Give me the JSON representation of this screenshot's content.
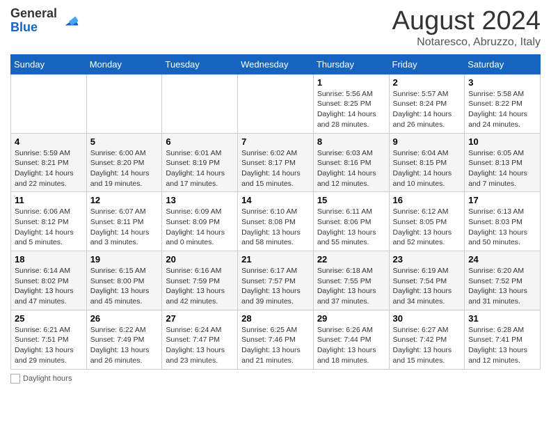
{
  "header": {
    "logo_general": "General",
    "logo_blue": "Blue",
    "month_title": "August 2024",
    "location": "Notaresco, Abruzzo, Italy"
  },
  "days_of_week": [
    "Sunday",
    "Monday",
    "Tuesday",
    "Wednesday",
    "Thursday",
    "Friday",
    "Saturday"
  ],
  "weeks": [
    [
      {
        "day": "",
        "info": ""
      },
      {
        "day": "",
        "info": ""
      },
      {
        "day": "",
        "info": ""
      },
      {
        "day": "",
        "info": ""
      },
      {
        "day": "1",
        "info": "Sunrise: 5:56 AM\nSunset: 8:25 PM\nDaylight: 14 hours and 28 minutes."
      },
      {
        "day": "2",
        "info": "Sunrise: 5:57 AM\nSunset: 8:24 PM\nDaylight: 14 hours and 26 minutes."
      },
      {
        "day": "3",
        "info": "Sunrise: 5:58 AM\nSunset: 8:22 PM\nDaylight: 14 hours and 24 minutes."
      }
    ],
    [
      {
        "day": "4",
        "info": "Sunrise: 5:59 AM\nSunset: 8:21 PM\nDaylight: 14 hours and 22 minutes."
      },
      {
        "day": "5",
        "info": "Sunrise: 6:00 AM\nSunset: 8:20 PM\nDaylight: 14 hours and 19 minutes."
      },
      {
        "day": "6",
        "info": "Sunrise: 6:01 AM\nSunset: 8:19 PM\nDaylight: 14 hours and 17 minutes."
      },
      {
        "day": "7",
        "info": "Sunrise: 6:02 AM\nSunset: 8:17 PM\nDaylight: 14 hours and 15 minutes."
      },
      {
        "day": "8",
        "info": "Sunrise: 6:03 AM\nSunset: 8:16 PM\nDaylight: 14 hours and 12 minutes."
      },
      {
        "day": "9",
        "info": "Sunrise: 6:04 AM\nSunset: 8:15 PM\nDaylight: 14 hours and 10 minutes."
      },
      {
        "day": "10",
        "info": "Sunrise: 6:05 AM\nSunset: 8:13 PM\nDaylight: 14 hours and 7 minutes."
      }
    ],
    [
      {
        "day": "11",
        "info": "Sunrise: 6:06 AM\nSunset: 8:12 PM\nDaylight: 14 hours and 5 minutes."
      },
      {
        "day": "12",
        "info": "Sunrise: 6:07 AM\nSunset: 8:11 PM\nDaylight: 14 hours and 3 minutes."
      },
      {
        "day": "13",
        "info": "Sunrise: 6:09 AM\nSunset: 8:09 PM\nDaylight: 14 hours and 0 minutes."
      },
      {
        "day": "14",
        "info": "Sunrise: 6:10 AM\nSunset: 8:08 PM\nDaylight: 13 hours and 58 minutes."
      },
      {
        "day": "15",
        "info": "Sunrise: 6:11 AM\nSunset: 8:06 PM\nDaylight: 13 hours and 55 minutes."
      },
      {
        "day": "16",
        "info": "Sunrise: 6:12 AM\nSunset: 8:05 PM\nDaylight: 13 hours and 52 minutes."
      },
      {
        "day": "17",
        "info": "Sunrise: 6:13 AM\nSunset: 8:03 PM\nDaylight: 13 hours and 50 minutes."
      }
    ],
    [
      {
        "day": "18",
        "info": "Sunrise: 6:14 AM\nSunset: 8:02 PM\nDaylight: 13 hours and 47 minutes."
      },
      {
        "day": "19",
        "info": "Sunrise: 6:15 AM\nSunset: 8:00 PM\nDaylight: 13 hours and 45 minutes."
      },
      {
        "day": "20",
        "info": "Sunrise: 6:16 AM\nSunset: 7:59 PM\nDaylight: 13 hours and 42 minutes."
      },
      {
        "day": "21",
        "info": "Sunrise: 6:17 AM\nSunset: 7:57 PM\nDaylight: 13 hours and 39 minutes."
      },
      {
        "day": "22",
        "info": "Sunrise: 6:18 AM\nSunset: 7:55 PM\nDaylight: 13 hours and 37 minutes."
      },
      {
        "day": "23",
        "info": "Sunrise: 6:19 AM\nSunset: 7:54 PM\nDaylight: 13 hours and 34 minutes."
      },
      {
        "day": "24",
        "info": "Sunrise: 6:20 AM\nSunset: 7:52 PM\nDaylight: 13 hours and 31 minutes."
      }
    ],
    [
      {
        "day": "25",
        "info": "Sunrise: 6:21 AM\nSunset: 7:51 PM\nDaylight: 13 hours and 29 minutes."
      },
      {
        "day": "26",
        "info": "Sunrise: 6:22 AM\nSunset: 7:49 PM\nDaylight: 13 hours and 26 minutes."
      },
      {
        "day": "27",
        "info": "Sunrise: 6:24 AM\nSunset: 7:47 PM\nDaylight: 13 hours and 23 minutes."
      },
      {
        "day": "28",
        "info": "Sunrise: 6:25 AM\nSunset: 7:46 PM\nDaylight: 13 hours and 21 minutes."
      },
      {
        "day": "29",
        "info": "Sunrise: 6:26 AM\nSunset: 7:44 PM\nDaylight: 13 hours and 18 minutes."
      },
      {
        "day": "30",
        "info": "Sunrise: 6:27 AM\nSunset: 7:42 PM\nDaylight: 13 hours and 15 minutes."
      },
      {
        "day": "31",
        "info": "Sunrise: 6:28 AM\nSunset: 7:41 PM\nDaylight: 13 hours and 12 minutes."
      }
    ]
  ],
  "footer": {
    "note": "Daylight hours"
  }
}
